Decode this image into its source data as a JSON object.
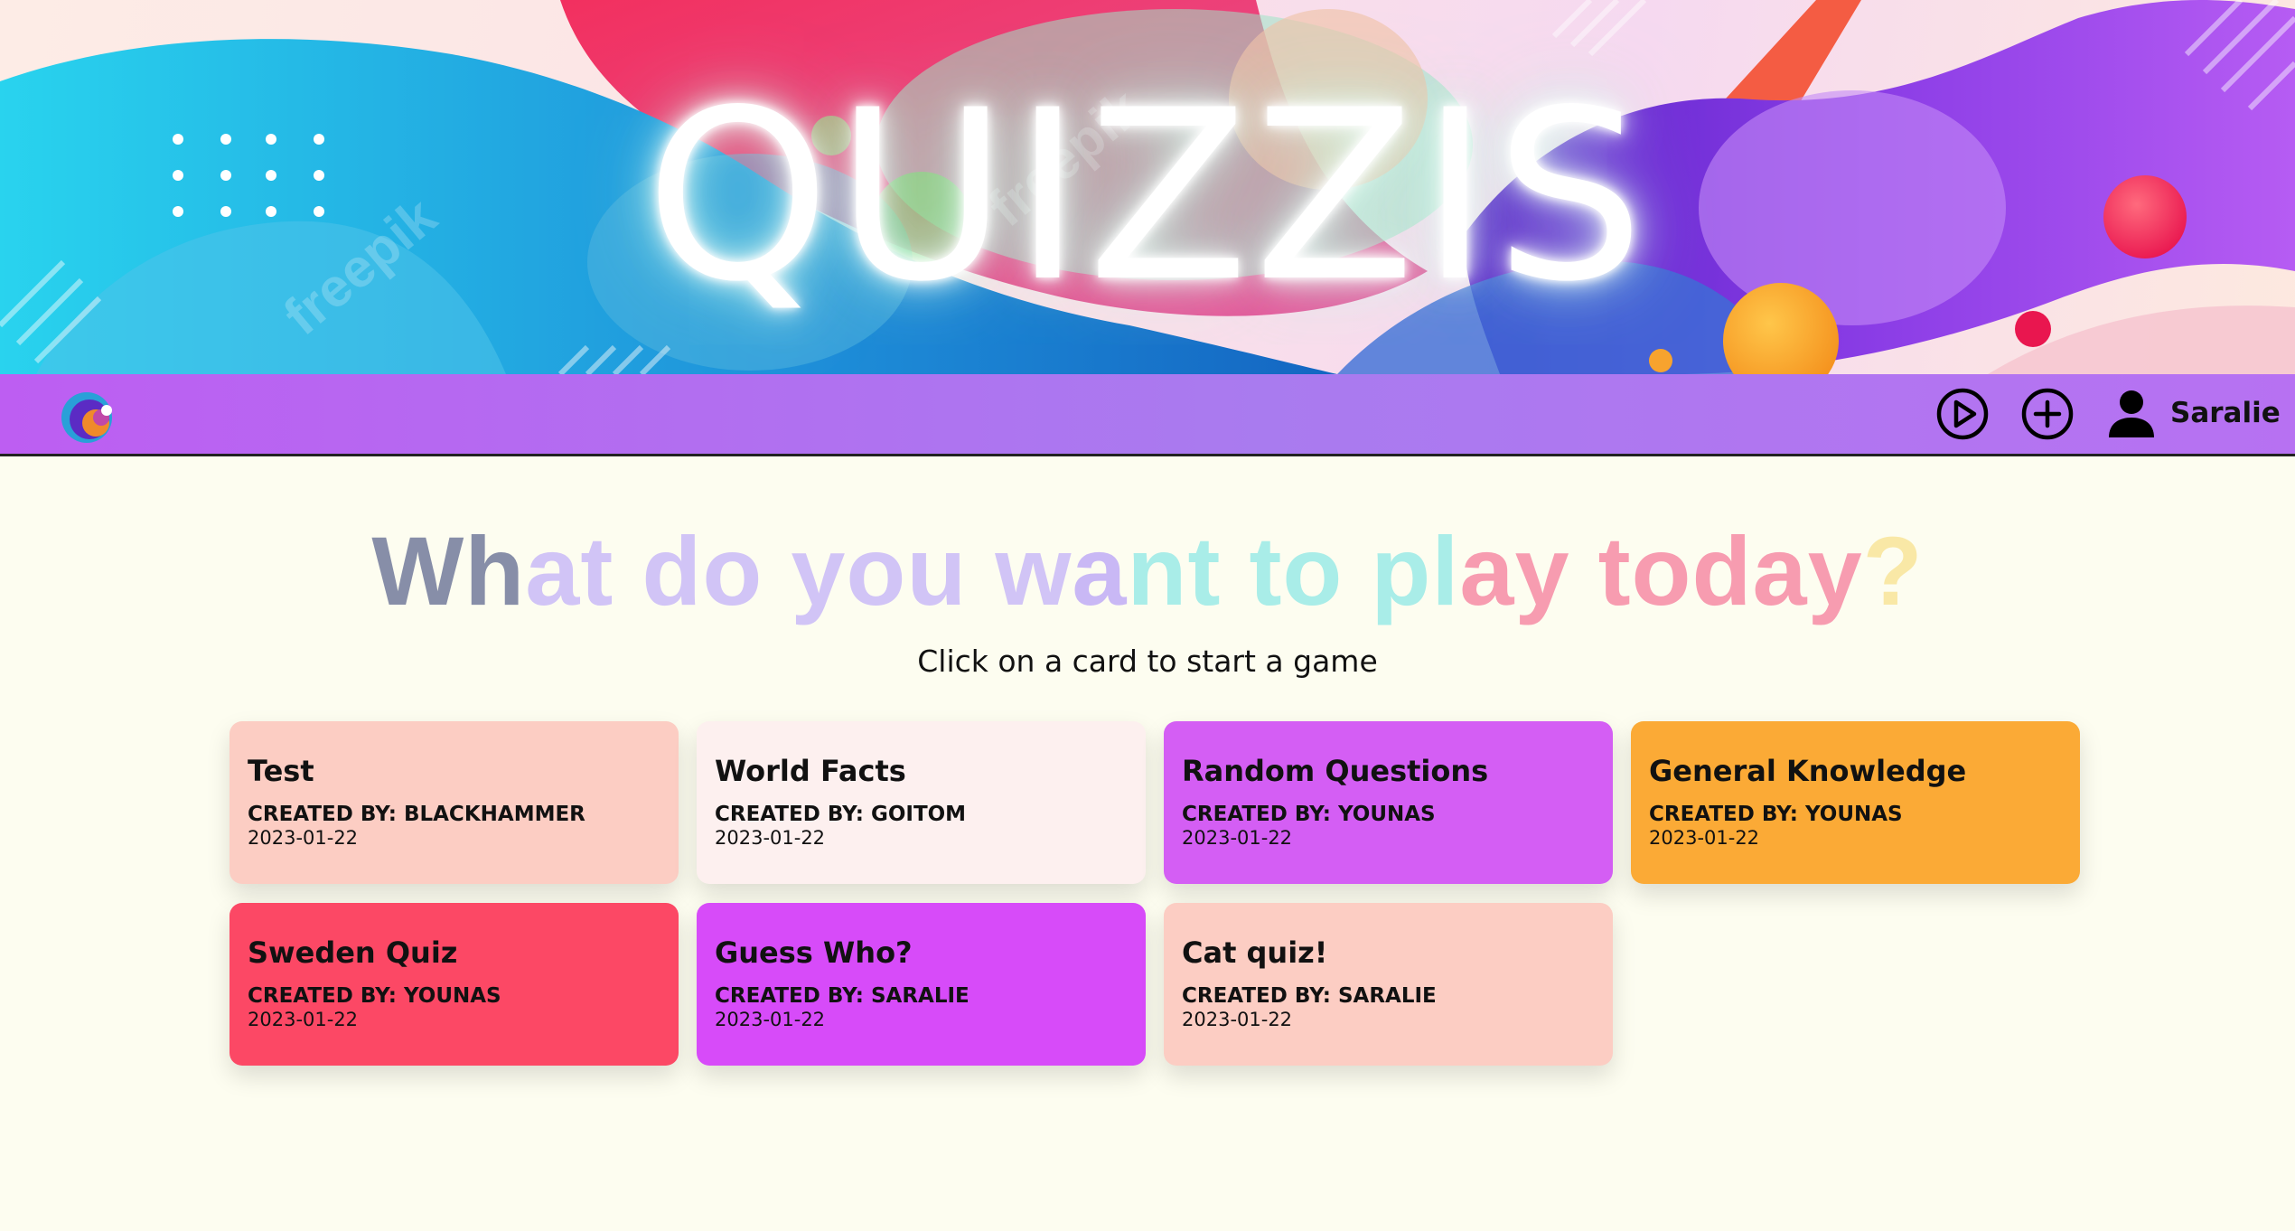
{
  "app": {
    "title": "QUIZZIS",
    "watermarks": [
      "freepik",
      "freepik"
    ]
  },
  "nav": {
    "logo_icon": "swirl-logo-icon",
    "play_icon": "play-circle-icon",
    "add_icon": "plus-circle-icon",
    "user_icon": "user-icon",
    "username": "Saralie"
  },
  "main": {
    "headline": "What do you want to play today?",
    "subtitle": "Click on a card to start a game"
  },
  "colors": {
    "navbar_start": "#bd5ef2",
    "navbar_end": "#a97bef",
    "page_bg": "#fdfdf0",
    "headline_letters": [
      "#878ea8",
      "#878ea8",
      "#d1c4f6",
      "#d1c4f6",
      "#d1c4f6",
      "#d1c4f6",
      "#d1c4f6",
      "#d1c4f6",
      "#d1c4f6",
      "#d1c4f6",
      "#c9b8f5",
      "#a9ede8",
      "#a9ede8",
      "#a9ede8",
      "#a9ede8",
      "#a9ede8",
      "#a9ede8",
      "#f79cb0",
      "#f79cb0",
      "#f79cb0",
      "#f79cb0",
      "#f79cb0",
      "#f79cb0",
      "#f79cb0",
      "#f79cb0",
      "#89e0fa",
      "#89e0fa",
      "#89e0fa",
      "#89e0fa",
      "#89e0fa",
      "#89e0fa",
      "#89e0fa"
    ]
  },
  "cards": [
    {
      "title": "Test",
      "author": "CREATED BY: BLACKHAMMER",
      "date": "2023-01-22",
      "color": "#fccdc3"
    },
    {
      "title": "World Facts",
      "author": "CREATED BY: GOITOM",
      "date": "2023-01-22",
      "color": "#fdf0ef"
    },
    {
      "title": "Random Questions",
      "author": "CREATED BY: YOUNAS",
      "date": "2023-01-22",
      "color": "#d45ef4"
    },
    {
      "title": "General Knowledge",
      "author": "CREATED BY: YOUNAS",
      "date": "2023-01-22",
      "color": "#fbaa36"
    },
    {
      "title": "Sweden Quiz",
      "author": "CREATED BY: YOUNAS",
      "date": "2023-01-22",
      "color": "#fc4865"
    },
    {
      "title": "Guess Who?",
      "author": "CREATED BY: SARALIE",
      "date": "2023-01-22",
      "color": "#d74bf9"
    },
    {
      "title": "Cat quiz!",
      "author": "CREATED BY: SARALIE",
      "date": "2023-01-22",
      "color": "#fccdc3"
    }
  ]
}
